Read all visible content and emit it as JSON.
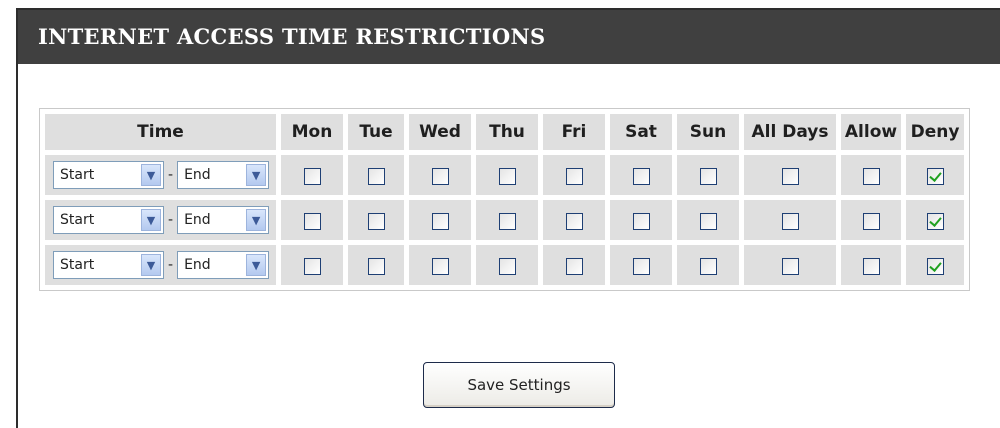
{
  "panel": {
    "title": "INTERNET ACCESS TIME RESTRICTIONS"
  },
  "table": {
    "headers": [
      "Time",
      "Mon",
      "Tue",
      "Wed",
      "Thu",
      "Fri",
      "Sat",
      "Sun",
      "All Days",
      "Allow",
      "Deny"
    ],
    "rows": [
      {
        "start": "Start",
        "end": "End",
        "separator": "-",
        "mon": false,
        "tue": false,
        "wed": false,
        "thu": false,
        "fri": false,
        "sat": false,
        "sun": false,
        "all_days": false,
        "allow": false,
        "deny": true
      },
      {
        "start": "Start",
        "end": "End",
        "separator": "-",
        "mon": false,
        "tue": false,
        "wed": false,
        "thu": false,
        "fri": false,
        "sat": false,
        "sun": false,
        "all_days": false,
        "allow": false,
        "deny": true
      },
      {
        "start": "Start",
        "end": "End",
        "separator": "-",
        "mon": false,
        "tue": false,
        "wed": false,
        "thu": false,
        "fri": false,
        "sat": false,
        "sun": false,
        "all_days": false,
        "allow": false,
        "deny": true
      }
    ]
  },
  "save_button": {
    "label": "Save Settings"
  },
  "icons": {
    "dropdown": "chevron-down-icon"
  }
}
